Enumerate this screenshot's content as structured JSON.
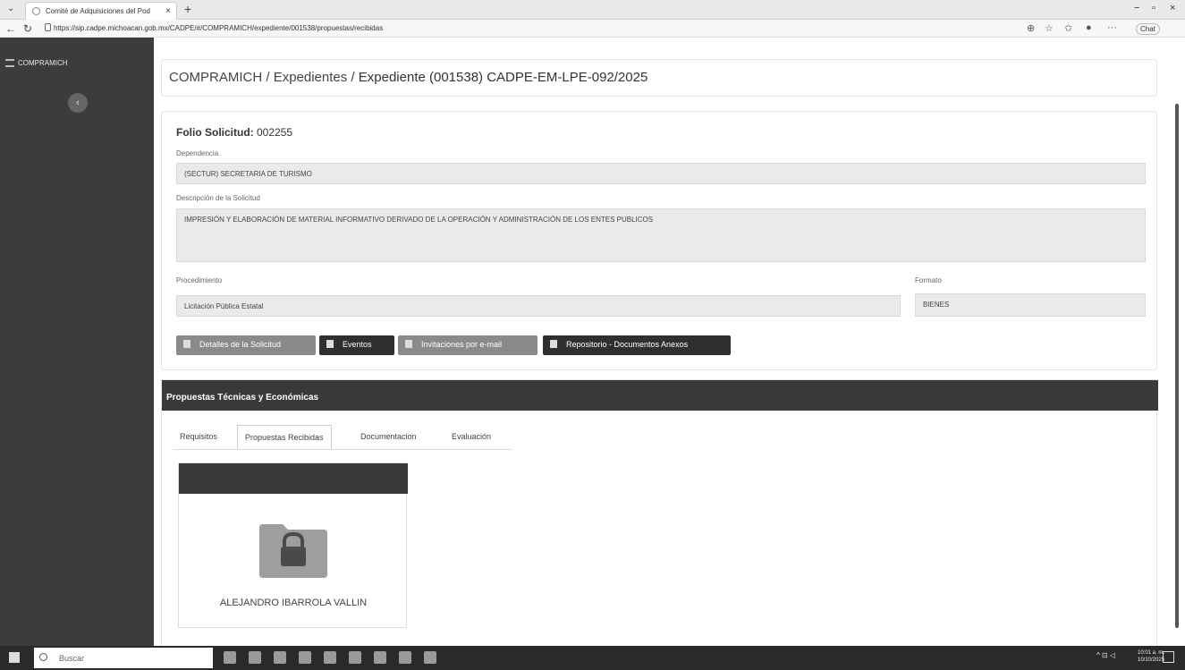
{
  "browser": {
    "tab_title": "Comité de Adquisiciones del Pod",
    "tab_close": "×",
    "new_tab": "+",
    "url": "https://sip.cadpe.michoacan.gob.mx/CADPE/#/COMPRAMICH/expediente/001538/propuestas/recibidas",
    "chat_label": "Chat",
    "minimize": "−",
    "restore": "▫",
    "close": "×"
  },
  "sidebar": {
    "brand": "COMPRAMICH",
    "collapse": "‹"
  },
  "breadcrumb": {
    "root": "COMPRAMICH",
    "sep1": " / ",
    "section": "Expedientes",
    "sep2": " / ",
    "current": "Expediente (001538) CADPE-EM-LPE-092/2025"
  },
  "form": {
    "folio_label": "Folio Solicitud:",
    "folio_value": " 002255",
    "dependencia_label": "Dependencia",
    "dependencia_value": "(SECTUR)  SECRETARIA DE TURISMO",
    "descripcion_label": "Descripción de la Solicitud",
    "descripcion_value": "IMPRESIÓN Y ELABORACIÓN DE MATERIAL  INFORMATIVO  DERIVADO DE LA OPERACIÓN Y ADMINISTRACIÓN DE LOS ENTES PUBLICOS",
    "procedimiento_label": "Procedimiento",
    "procedimiento_value": "Licitación Pública Estatal",
    "formato_label": "Formato",
    "formato_value": "BIENES"
  },
  "actions": {
    "detalles": "Detalles de la Solicitud",
    "eventos": "Eventos",
    "invitaciones": "Invitaciones por e-mail",
    "repositorio": "Repositorio - Documentos Anexos"
  },
  "proposals": {
    "title": "Propuestas Técnicas y Económicas",
    "tabs": [
      "Requisitos",
      "Propuestas Recibidas",
      "Documentacion",
      "Evaluación"
    ],
    "active_tab": "Propuestas Recibidas",
    "cards": [
      {
        "name": "ALEJANDRO IBARROLA VALLIN",
        "icon": "lock-folder-icon"
      }
    ]
  },
  "taskbar": {
    "search_placeholder": "Buscar",
    "time": "10:01 a. m.",
    "date": "10/10/2025"
  },
  "colors": {
    "sidebar": "#3c3c3c",
    "header_dark": "#3a3a3a",
    "button_dark": "#2f2f2f",
    "button_disabled": "#8a8a8a",
    "field_bg": "#eaeaea"
  }
}
